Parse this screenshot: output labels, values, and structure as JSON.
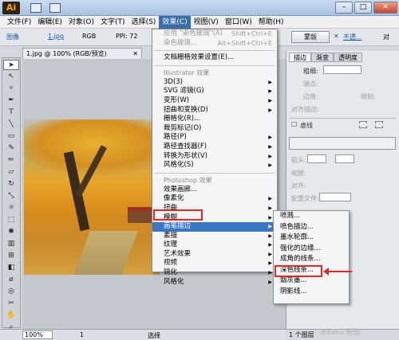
{
  "app": {
    "logo": "Ai"
  },
  "window_controls": {
    "minimize": "–",
    "maximize": "□",
    "close": "✕"
  },
  "menubar": [
    {
      "label": "文件(F)"
    },
    {
      "label": "编辑(E)"
    },
    {
      "label": "对象(O)"
    },
    {
      "label": "文字(T)"
    },
    {
      "label": "选择(S)"
    },
    {
      "label": "效果(C)",
      "active": true
    },
    {
      "label": "视图(V)"
    },
    {
      "label": "窗口(W)"
    },
    {
      "label": "帮助(H)"
    }
  ],
  "controlbar": {
    "image_label": "图像",
    "file_name": "1.jpg",
    "color_mode": "RGB",
    "ppi": "PPI: 72",
    "mask_button": "蒙版",
    "opacity_label": "不透...",
    "link_text": "对"
  },
  "document": {
    "tab_title": "1.jpg @ 100% (RGB/预览)",
    "close": "✕"
  },
  "statusbar": {
    "zoom": "100%",
    "page": "1",
    "selection_label": "选择"
  },
  "rpanel": {
    "tabs": [
      "描边",
      "渐变",
      "透明度"
    ],
    "weight_label": "粗细:",
    "cap_label": "端点:",
    "corner_label": "边角:",
    "limit_label": "限制:",
    "align_label": "对齐描边:",
    "dashed_label": "虚线",
    "arrow_label": "箭头:",
    "scale_label": "缩放:",
    "align2_label": "对齐:",
    "profile_label": "配置文件:",
    "layers_label": "1 个图层"
  },
  "effect_menu": {
    "top": [
      {
        "label": "应用 \"染色玻璃\"(A)",
        "shortcut": "Shift+Ctrl+E",
        "dim": true
      },
      {
        "label": "染色玻璃...",
        "shortcut": "Alt+Shift+Ctrl+E",
        "dim": true
      }
    ],
    "doc_raster": "文档栅格效果设置(E)...",
    "illustrator_section": "Illustrator 效果",
    "illustrator_items": [
      {
        "label": "3D(3)",
        "sub": true
      },
      {
        "label": "SVG 滤镜(G)",
        "sub": true
      },
      {
        "label": "变形(W)",
        "sub": true
      },
      {
        "label": "扭曲和变换(D)",
        "sub": true
      },
      {
        "label": "栅格化(R)...",
        "sub": false
      },
      {
        "label": "裁剪标记(O)",
        "sub": false
      },
      {
        "label": "路径(P)",
        "sub": true
      },
      {
        "label": "路径查找器(F)",
        "sub": true
      },
      {
        "label": "转换为形状(V)",
        "sub": true
      },
      {
        "label": "风格化(S)",
        "sub": true
      }
    ],
    "photoshop_section": "Photoshop 效果",
    "photoshop_items": [
      {
        "label": "效果画廊...",
        "sub": false
      },
      {
        "label": "像素化",
        "sub": true
      },
      {
        "label": "扭曲",
        "sub": true
      },
      {
        "label": "模糊",
        "sub": true
      },
      {
        "label": "画笔描边",
        "sub": true,
        "highlight": true
      },
      {
        "label": "素描",
        "sub": true
      },
      {
        "label": "纹理",
        "sub": true
      },
      {
        "label": "艺术效果",
        "sub": true
      },
      {
        "label": "视频",
        "sub": true
      },
      {
        "label": "锐化",
        "sub": true
      },
      {
        "label": "风格化",
        "sub": true
      }
    ]
  },
  "brush_submenu": [
    {
      "label": "喷溅..."
    },
    {
      "label": "喷色描边..."
    },
    {
      "label": "墨水轮廓..."
    },
    {
      "label": "强化的边缘..."
    },
    {
      "label": "成角的线条..."
    },
    {
      "label": "深色线条...",
      "boxed": true
    },
    {
      "label": "烟灰墨..."
    },
    {
      "label": "阴影线..."
    }
  ],
  "watermark": "Baidu 经验"
}
